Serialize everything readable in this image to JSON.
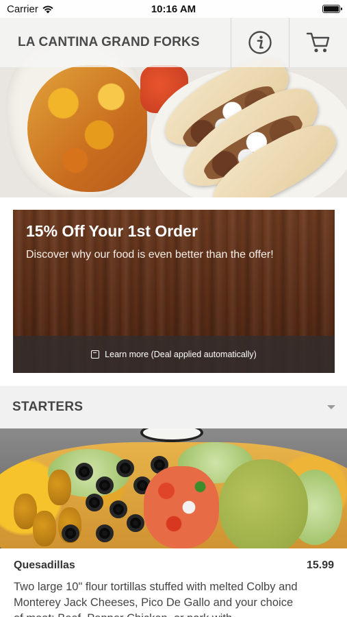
{
  "status_bar": {
    "carrier": "Carrier",
    "time": "10:16 AM"
  },
  "header": {
    "title": "LA CANTINA GRAND FORKS",
    "info_icon": "info-circle-icon",
    "cart_icon": "cart-icon"
  },
  "promo": {
    "title": "15% Off Your 1st Order",
    "subtitle": "Discover why our food is even better than the offer!",
    "footer_text": "Learn more (Deal applied automatically)"
  },
  "section": {
    "title": "STARTERS"
  },
  "menu_item": {
    "name": "Quesadillas",
    "price": "15.99",
    "description": "Two large 10\" flour tortillas stuffed with melted Colby and Monterey Jack Cheeses, Pico De Gallo and your choice of meat: Beef, Pepper Chicken, or pork with"
  },
  "colors": {
    "header_text": "#4a4a4a",
    "promo_bg": "#5a2d17",
    "section_bg": "#f1f1f1"
  }
}
